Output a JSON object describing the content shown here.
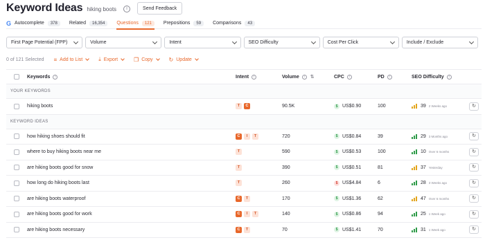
{
  "header": {
    "title": "Keyword Ideas",
    "subtitle": "hiking boots",
    "info_icon": "i",
    "feedback_label": "Send Feedback"
  },
  "tabs": [
    {
      "label": "Autocomplete",
      "count": "378",
      "icon": "google-icon",
      "icon_glyph": "G",
      "active": false
    },
    {
      "label": "Related",
      "count": "16,354",
      "active": false
    },
    {
      "label": "Questions",
      "count": "121",
      "active": true
    },
    {
      "label": "Prepositions",
      "count": "59",
      "active": false
    },
    {
      "label": "Comparisons",
      "count": "43",
      "active": false
    }
  ],
  "filters": [
    {
      "label": "First Page Potential (FPP)"
    },
    {
      "label": "Volume"
    },
    {
      "label": "Intent"
    },
    {
      "label": "SEO Difficulty"
    },
    {
      "label": "Cost Per Click"
    },
    {
      "label": "Include / Exclude"
    }
  ],
  "actions": {
    "selected_text": "0 of 121 Selected",
    "add_to_list": "Add to List",
    "export": "Export",
    "copy": "Copy",
    "update": "Update"
  },
  "columns": {
    "keywords": "Keywords",
    "intent": "Intent",
    "volume": "Volume",
    "cpc": "CPC",
    "pd": "PD",
    "seo": "SEO Difficulty"
  },
  "sections": {
    "your_keywords": "YOUR KEYWORDS",
    "keyword_ideas": "KEYWORD IDEAS"
  },
  "your_keyword": {
    "keyword": "hiking boots",
    "intent": [
      "T",
      "C"
    ],
    "volume": "90.5K",
    "cpc": "US$0.90",
    "cpc_level": "green",
    "pd": "100",
    "seo": "39",
    "seo_level": "medium",
    "seo_time": "2 Weeks ago"
  },
  "rows": [
    {
      "keyword": "how hiking shoes should fit",
      "intent": [
        "C",
        "I",
        "T"
      ],
      "volume": "720",
      "cpc": "US$0.84",
      "cpc_level": "green",
      "pd": "39",
      "seo": "29",
      "seo_level": "easy",
      "seo_time": "3 Months ago"
    },
    {
      "keyword": "where to buy hiking boots near me",
      "intent": [
        "T"
      ],
      "volume": "590",
      "cpc": "US$0.53",
      "cpc_level": "green",
      "pd": "100",
      "seo": "10",
      "seo_level": "easy",
      "seo_time": "Over 6 months"
    },
    {
      "keyword": "are hiking boots good for snow",
      "intent": [
        "T"
      ],
      "volume": "390",
      "cpc": "US$0.51",
      "cpc_level": "green",
      "pd": "81",
      "seo": "37",
      "seo_level": "medium",
      "seo_time": "Yesterday"
    },
    {
      "keyword": "how long do hiking boots last",
      "intent": [
        "T"
      ],
      "volume": "260",
      "cpc": "US$4.84",
      "cpc_level": "red",
      "pd": "6",
      "seo": "28",
      "seo_level": "easy",
      "seo_time": "3 Weeks ago"
    },
    {
      "keyword": "are hiking boots waterproof",
      "intent": [
        "C",
        "T"
      ],
      "volume": "170",
      "cpc": "US$1.36",
      "cpc_level": "green",
      "pd": "62",
      "seo": "47",
      "seo_level": "medium",
      "seo_time": "Over 6 months"
    },
    {
      "keyword": "are hiking boots good for work",
      "intent": [
        "C",
        "I",
        "T"
      ],
      "volume": "140",
      "cpc": "US$0.86",
      "cpc_level": "green",
      "pd": "94",
      "seo": "25",
      "seo_level": "easy",
      "seo_time": "1 Week ago"
    },
    {
      "keyword": "are hiking boots necessary",
      "intent": [
        "C",
        "T"
      ],
      "volume": "70",
      "cpc": "US$1.41",
      "cpc_level": "green",
      "pd": "70",
      "seo": "31",
      "seo_level": "easy",
      "seo_time": "1 Week ago"
    }
  ],
  "colors": {
    "accent": "#e8672a",
    "easy": "#2e9b48",
    "medium": "#e3a51c",
    "cpc_green": "#2e9b48",
    "cpc_red": "#d33a2f"
  }
}
